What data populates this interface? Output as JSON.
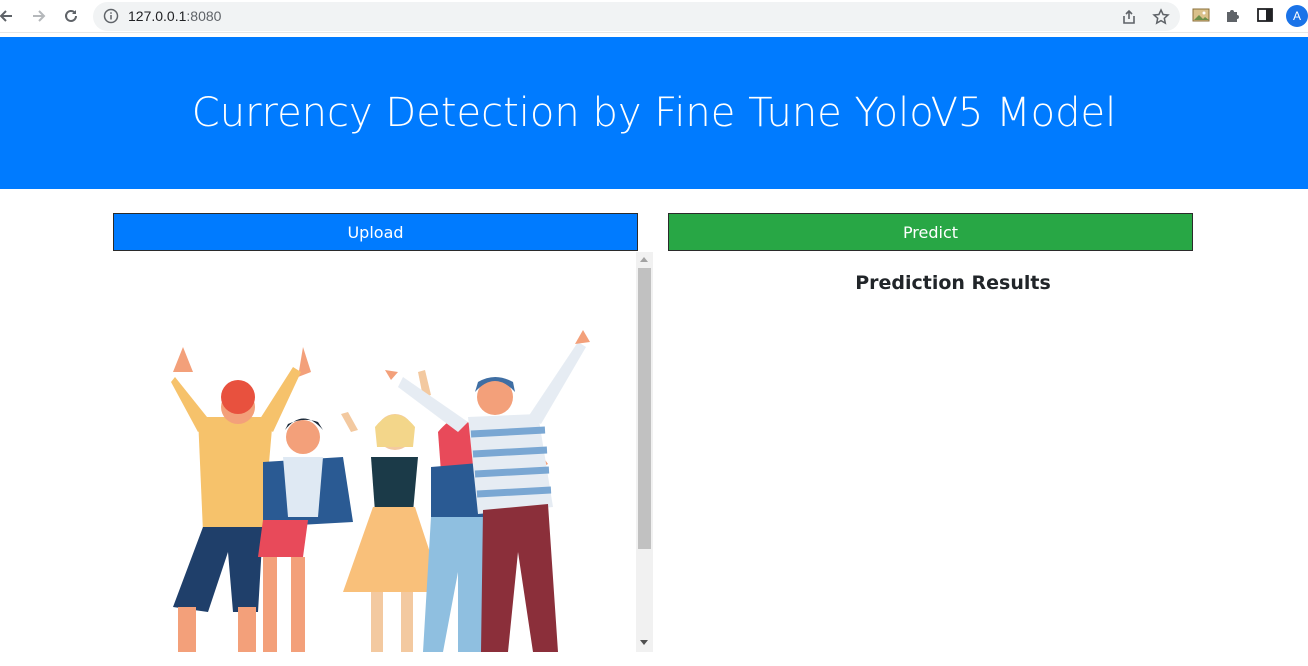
{
  "browser": {
    "url_host": "127.0.0.1",
    "url_port": ":8080",
    "profile_initial": "A",
    "icons": [
      "back-arrow-icon",
      "forward-arrow-icon",
      "reload-icon",
      "info-icon",
      "share-icon",
      "star-icon",
      "image-extension-icon",
      "puzzle-icon",
      "side-panel-icon"
    ]
  },
  "page": {
    "title": "Currency Detection by Fine Tune YoloV5 Model",
    "upload_label": "Upload",
    "predict_label": "Predict",
    "results_heading": "Prediction Results"
  },
  "colors": {
    "primary": "#007bff",
    "success": "#28a745"
  }
}
